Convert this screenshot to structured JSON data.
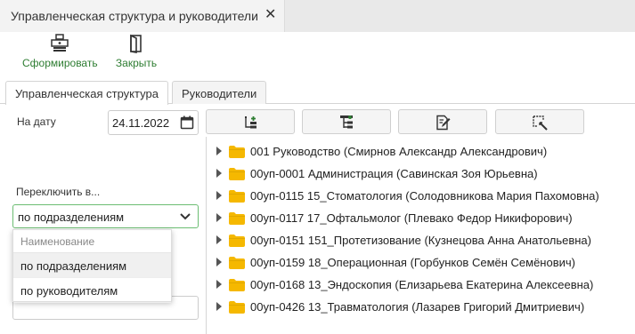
{
  "window": {
    "tab_title": "Управленческая структура и руководители",
    "close_glyph": "✕"
  },
  "toolbar": {
    "form_label": "Сформировать",
    "close_label": "Закрыть"
  },
  "tabs": [
    {
      "label": "Управленческая структура",
      "active": true
    },
    {
      "label": "Руководители",
      "active": false
    }
  ],
  "filters": {
    "date_label": "На дату",
    "date_value": "24.11.2022",
    "switch_label": "Переключить в...",
    "switch_value": "по подразделениям",
    "dropdown": {
      "header": "Наименование",
      "options": [
        "по подразделениям",
        "по руководителям"
      ]
    }
  },
  "actions": [
    {
      "icon": "add-child-icon"
    },
    {
      "icon": "tree-expand-icon"
    },
    {
      "icon": "edit-document-icon"
    },
    {
      "icon": "select-wand-icon"
    }
  ],
  "tree": [
    "001 Руководство (Смирнов Александр Александрович)",
    "00уп-0001 Администрация (Савинская Зоя Юрьевна)",
    "00уп-0115 15_Стоматология (Солодовникова Мария Пахомовна)",
    "00уп-0117 17_Офтальмолог (Плевако Федор Никифорович)",
    "00уп-0151 151_Протетизование (Кузнецова Анна Анатольевна)",
    "00уп-0159 18_Операционная (Горбунков Семён Семёнович)",
    "00уп-0168 13_Эндоскопия (Елизарьева Екатерина Алексеевна)",
    "00уп-0426 13_Травматология (Лазарев Григорий Дмитриевич)"
  ],
  "colors": {
    "accent_green": "#2e7d32",
    "folder": "#f5b800",
    "select_border": "#6bbd72"
  }
}
